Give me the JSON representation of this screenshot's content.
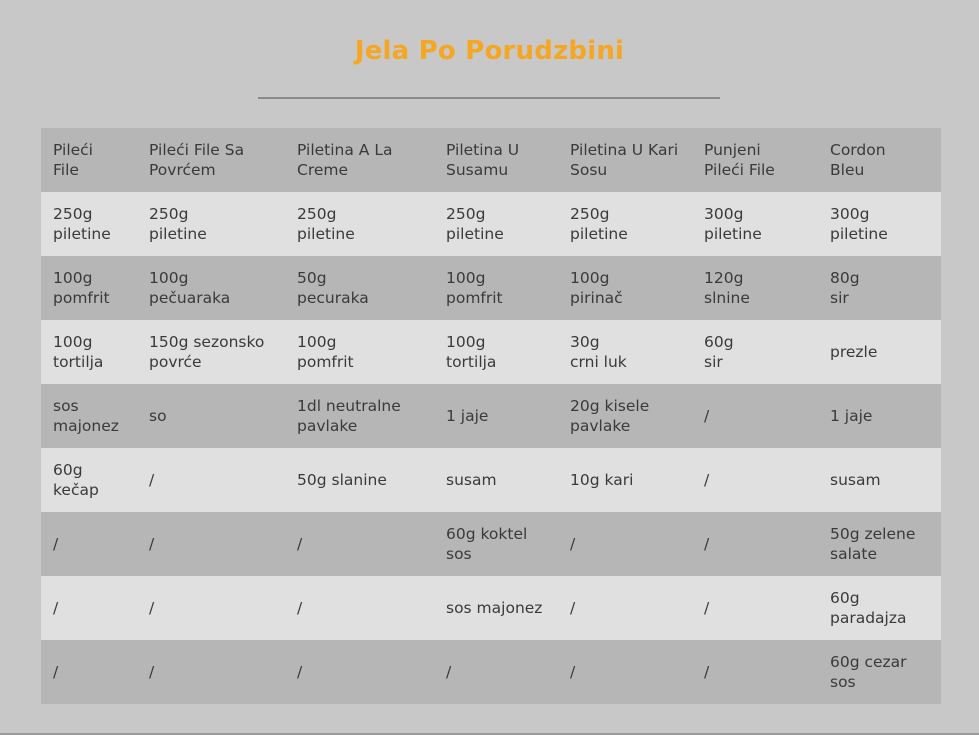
{
  "title": "Jela Po Porudzbini",
  "colors": {
    "title": "#f5a623",
    "background": "#c8c8c8",
    "row_dark": "#b6b6b6",
    "row_light": "#e0e0e0",
    "text": "#3a3a3a"
  },
  "table": {
    "headers": [
      "Pileći\nFile",
      "Pileći File Sa\nPovrćem",
      "Piletina A La\nCreme",
      "Piletina U\nSusamu",
      "Piletina U Kari\nSosu",
      "Punjeni\nPileći File",
      "Cordon\nBleu"
    ],
    "rows": [
      [
        "250g\npiletine",
        "250g\npiletine",
        "250g\npiletine",
        "250g\npiletine",
        "250g\npiletine",
        "300g\npiletine",
        "300g\npiletine"
      ],
      [
        "100g\npomfrit",
        "100g\npečuaraka",
        "50g\npecuraka",
        "100g\npomfrit",
        "100g\npirinač",
        "120g\nslnine",
        "80g\nsir"
      ],
      [
        "100g\ntortilja",
        "150g sezonsko\npovrće",
        "100g\npomfrit",
        "100g\ntortilja",
        "30g\ncrni luk",
        "60g\nsir",
        "prezle"
      ],
      [
        "sos\nmajonez",
        "so",
        "1dl neutralne\npavlake",
        "1 jaje",
        "20g kisele\npavlake",
        "/",
        "1 jaje"
      ],
      [
        "60g\nkečap",
        "/",
        "50g slanine",
        "susam",
        "10g kari",
        "/",
        "susam"
      ],
      [
        "/",
        "/",
        "/",
        "60g koktel\nsos",
        "/",
        "/",
        "50g zelene\nsalate"
      ],
      [
        "/",
        "/",
        "/",
        "sos majonez",
        "/",
        "/",
        "60g\nparadajza"
      ],
      [
        "/",
        "/",
        "/",
        "/",
        "/",
        "/",
        "60g cezar\nsos"
      ]
    ]
  }
}
